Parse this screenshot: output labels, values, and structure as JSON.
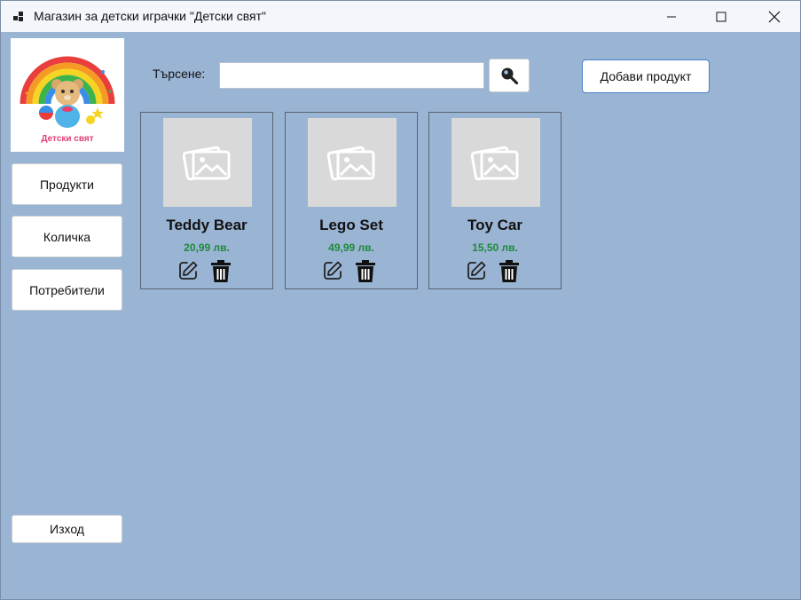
{
  "window": {
    "title": "Магазин за детски играчки \"Детски свят\""
  },
  "logo": {
    "text": "Детски свят"
  },
  "sidebar": {
    "items": [
      {
        "label": "Продукти"
      },
      {
        "label": "Количка"
      },
      {
        "label": "Потребители"
      }
    ],
    "exit_label": "Изход"
  },
  "search": {
    "label": "Търсене:",
    "value": ""
  },
  "toolbar": {
    "add_label": "Добави продукт"
  },
  "products": [
    {
      "name": "Teddy Bear",
      "price": "20,99 лв."
    },
    {
      "name": "Lego Set",
      "price": "49,99 лв."
    },
    {
      "name": "Toy Car",
      "price": "15,50 лв."
    }
  ],
  "colors": {
    "background": "#9ab4d4",
    "price": "#1e8a3a",
    "accent": "#4a7fc8"
  }
}
